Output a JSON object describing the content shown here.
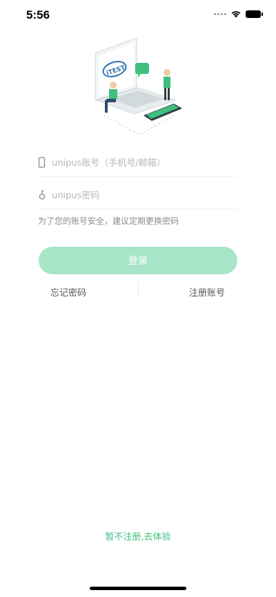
{
  "status": {
    "time": "5:56",
    "wifi_icon": "wifi-icon",
    "battery_icon": "battery-icon"
  },
  "illustration": {
    "icon": "laptop-illustration",
    "screen_logo": "iTEST"
  },
  "login_form": {
    "phone_placeholder": "unipus账号（手机号/邮箱）",
    "phone_icon": "phone-icon",
    "password_placeholder": "unipus密码",
    "password_icon": "key-icon",
    "hint": "为了您的账号安全，建议定期更换密码",
    "login_label": "登录"
  },
  "links": {
    "forgot": "忘记密码",
    "register": "注册账号",
    "try": "暂不注册,去体验"
  },
  "colors": {
    "accent": "#3fbf7f",
    "button_disabled": "#a8e5c8"
  }
}
